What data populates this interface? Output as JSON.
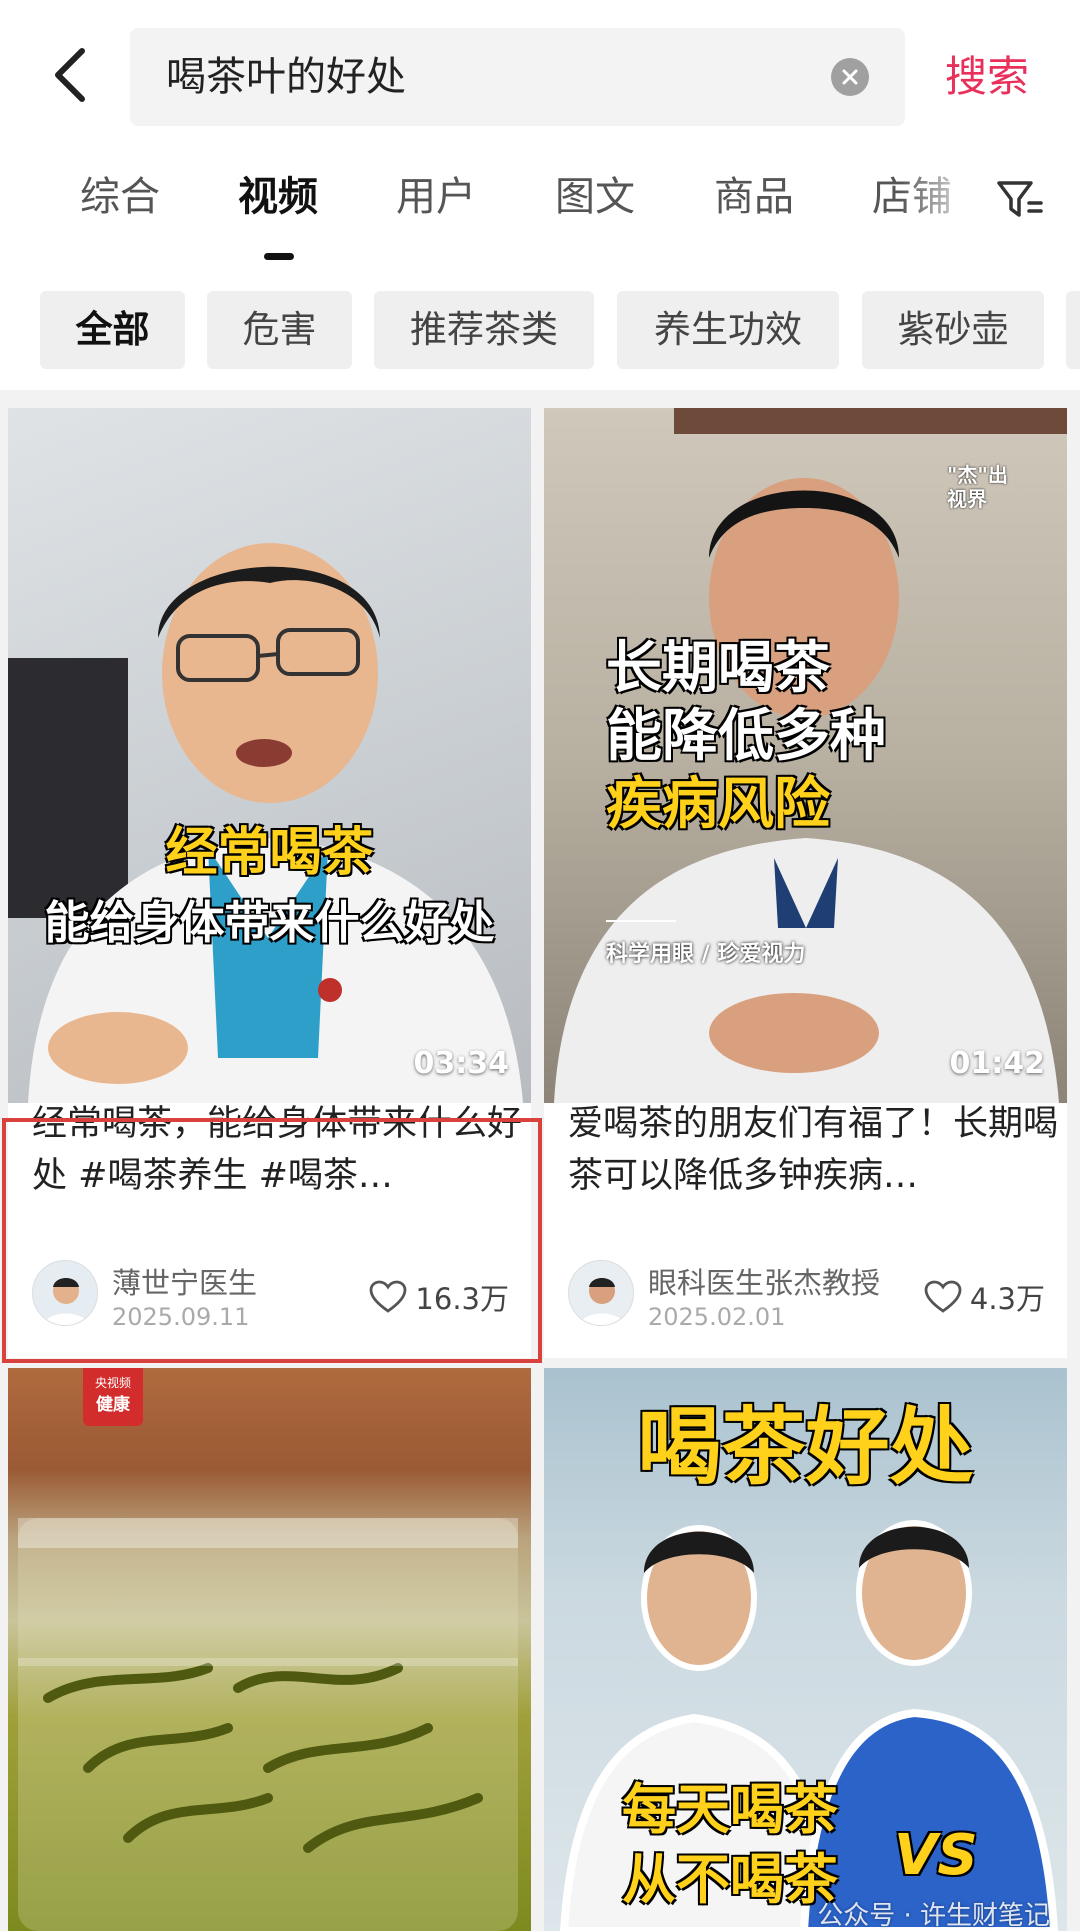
{
  "search": {
    "query": "喝茶叶的好处",
    "submit_label": "搜索"
  },
  "tabs": [
    {
      "label": "综合"
    },
    {
      "label": "视频"
    },
    {
      "label": "用户"
    },
    {
      "label": "图文"
    },
    {
      "label": "商品"
    },
    {
      "label": "店铺"
    }
  ],
  "active_tab": "视频",
  "chips": [
    {
      "label": "全部"
    },
    {
      "label": "危害"
    },
    {
      "label": "推荐茶类"
    },
    {
      "label": "养生功效"
    },
    {
      "label": "紫砂壶"
    }
  ],
  "cards": [
    {
      "overlay_line1": "经常喝茶",
      "overlay_line2": "能给身体带来什么好处",
      "duration": "03:34",
      "title": "经常喝茶，能给身体带来什么好处 #喝茶养生 #喝茶…",
      "author": "薄世宁医生",
      "date": "2025.09.11",
      "likes": "16.3万"
    },
    {
      "overlay_line1": "长期喝茶",
      "overlay_line2": "能降低多种",
      "overlay_line3": "疾病风险",
      "caption": "科学用眼 / 珍爱视力",
      "channel_logo": "\"杰\"出视界",
      "duration": "01:42",
      "title": "爱喝茶的朋友们有福了！长期喝茶可以降低多钟疾病…",
      "author": "眼科医生张杰教授",
      "date": "2025.02.01",
      "likes": "4.3万"
    },
    {
      "badge_top": "央视频",
      "badge_bottom": "健康"
    },
    {
      "overlay_title": "喝茶好处",
      "overlay_line1": "每天喝茶",
      "overlay_line2": "从不喝茶",
      "vs": "VS"
    }
  ],
  "watermark": "公众号 · 许生财笔记",
  "colors": {
    "accent": "#e8305a",
    "highlight_border": "#d9413c",
    "overlay_yellow": "#ffd11a"
  }
}
